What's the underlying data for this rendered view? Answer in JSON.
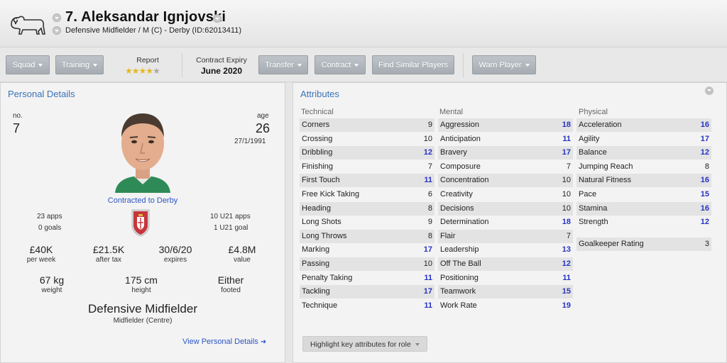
{
  "header": {
    "name": "7. Aleksandar Ignjovski",
    "subtitle": "Defensive Midfielder / M (C) - Derby (ID:62013411)"
  },
  "toolbar": {
    "squad": "Squad",
    "training": "Training",
    "report_label": "Report",
    "report_stars": 3.5,
    "contract_expiry_label": "Contract Expiry",
    "contract_expiry_value": "June 2020",
    "transfer": "Transfer",
    "contract": "Contract",
    "find_similar": "Find Similar Players",
    "warn_player": "Warn Player"
  },
  "personal": {
    "title": "Personal Details",
    "no_label": "no.",
    "no_value": "7",
    "age_label": "age",
    "age_value": "26",
    "dob": "27/1/1991",
    "contracted": "Contracted to Derby",
    "apps": "23 apps",
    "goals": "0 goals",
    "u21_apps": "10 U21 apps",
    "u21_goals": "1 U21 goal",
    "wage_value": "£40K",
    "wage_label": "per week",
    "after_tax_value": "£21.5K",
    "after_tax_label": "after tax",
    "expires_value": "30/6/20",
    "expires_label": "expires",
    "value_value": "£4.8M",
    "value_label": "value",
    "weight_value": "67 kg",
    "weight_label": "weight",
    "height_value": "175 cm",
    "height_label": "height",
    "foot_value": "Either",
    "foot_label": "footed",
    "role": "Defensive Midfielder",
    "position": "Midfielder (Centre)",
    "view_link": "View Personal Details"
  },
  "attributes": {
    "title": "Attributes",
    "technical_label": "Technical",
    "mental_label": "Mental",
    "physical_label": "Physical",
    "technical": [
      {
        "name": "Corners",
        "value": "9"
      },
      {
        "name": "Crossing",
        "value": "10"
      },
      {
        "name": "Dribbling",
        "value": "12"
      },
      {
        "name": "Finishing",
        "value": "7"
      },
      {
        "name": "First Touch",
        "value": "11"
      },
      {
        "name": "Free Kick Taking",
        "value": "6"
      },
      {
        "name": "Heading",
        "value": "8"
      },
      {
        "name": "Long Shots",
        "value": "9"
      },
      {
        "name": "Long Throws",
        "value": "8"
      },
      {
        "name": "Marking",
        "value": "17"
      },
      {
        "name": "Passing",
        "value": "10"
      },
      {
        "name": "Penalty Taking",
        "value": "11"
      },
      {
        "name": "Tackling",
        "value": "17"
      },
      {
        "name": "Technique",
        "value": "11"
      }
    ],
    "mental": [
      {
        "name": "Aggression",
        "value": "18"
      },
      {
        "name": "Anticipation",
        "value": "11"
      },
      {
        "name": "Bravery",
        "value": "17"
      },
      {
        "name": "Composure",
        "value": "7"
      },
      {
        "name": "Concentration",
        "value": "10"
      },
      {
        "name": "Creativity",
        "value": "10"
      },
      {
        "name": "Decisions",
        "value": "10"
      },
      {
        "name": "Determination",
        "value": "18"
      },
      {
        "name": "Flair",
        "value": "7"
      },
      {
        "name": "Leadership",
        "value": "13"
      },
      {
        "name": "Off The Ball",
        "value": "12"
      },
      {
        "name": "Positioning",
        "value": "11"
      },
      {
        "name": "Teamwork",
        "value": "15"
      },
      {
        "name": "Work Rate",
        "value": "19"
      }
    ],
    "physical": [
      {
        "name": "Acceleration",
        "value": "16"
      },
      {
        "name": "Agility",
        "value": "17"
      },
      {
        "name": "Balance",
        "value": "12"
      },
      {
        "name": "Jumping Reach",
        "value": "8"
      },
      {
        "name": "Natural Fitness",
        "value": "16"
      },
      {
        "name": "Pace",
        "value": "15"
      },
      {
        "name": "Stamina",
        "value": "16"
      },
      {
        "name": "Strength",
        "value": "12"
      }
    ],
    "goalkeeper_label": "Goalkeeper Rating",
    "goalkeeper_value": "3",
    "highlight_button": "Highlight key attributes for role"
  },
  "colors": {
    "accent_blue": "#3b73b9",
    "link_blue": "#2c56c5",
    "high_value": "#2733c4"
  }
}
